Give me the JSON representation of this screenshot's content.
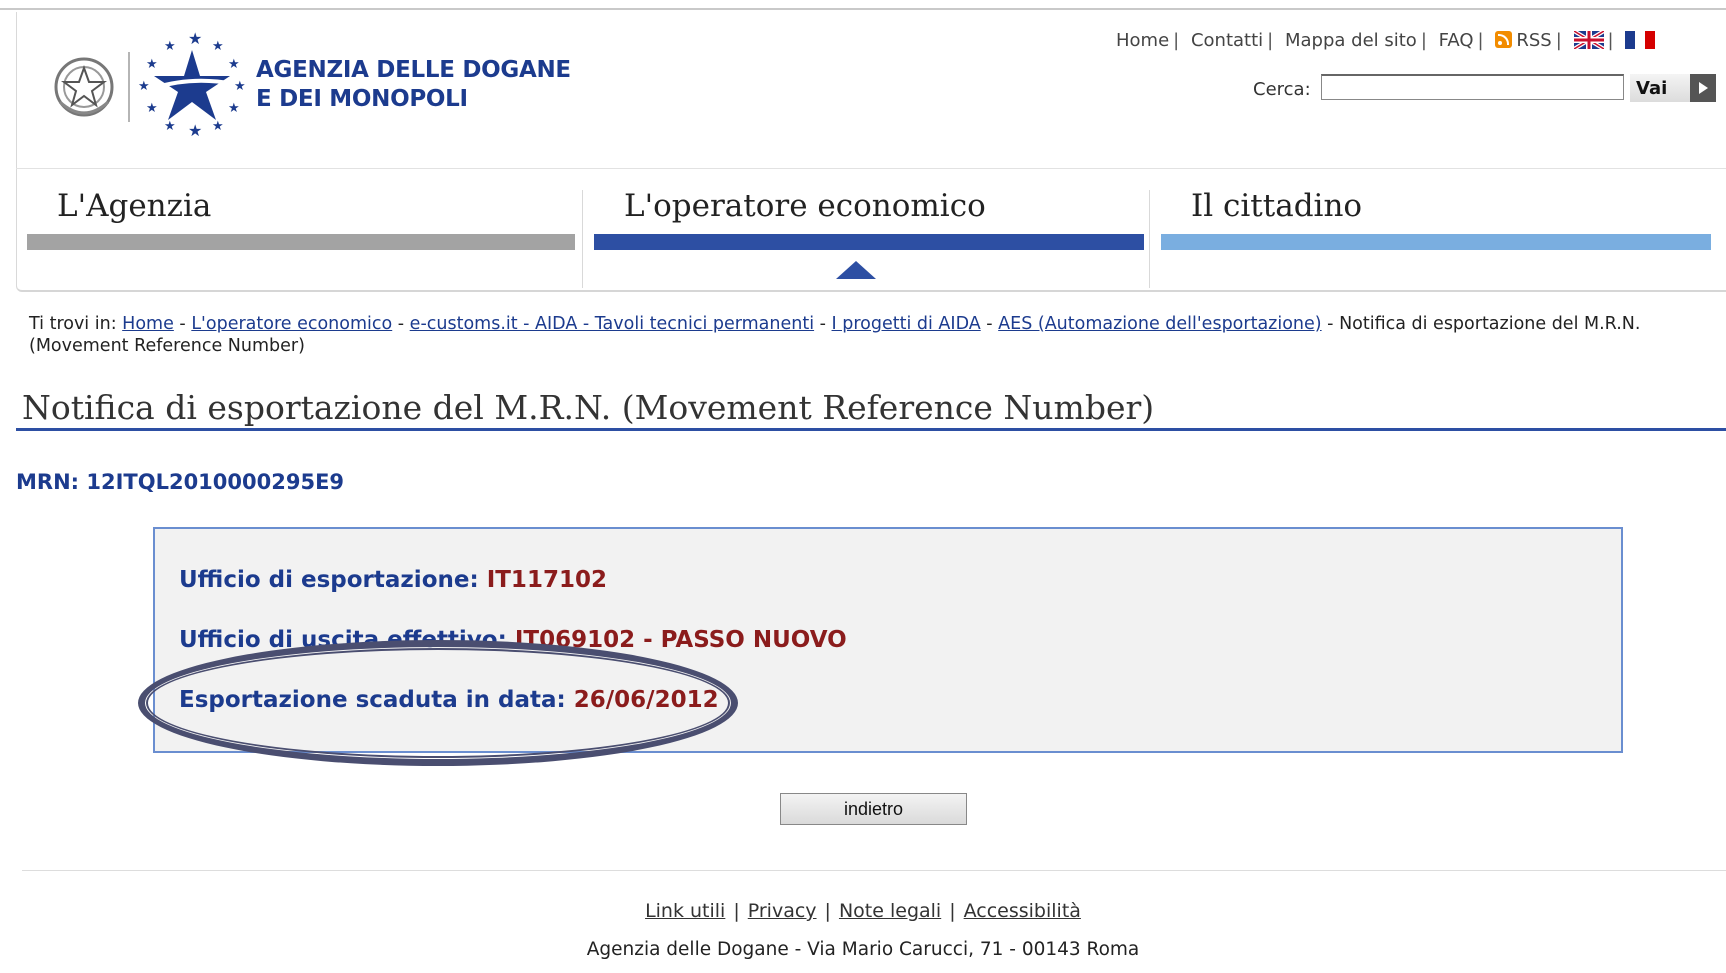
{
  "logo": {
    "line1": "AGENZIA DELLE DOGANE",
    "line2": "E DEI MONOPOLI"
  },
  "top_links": [
    {
      "label": "Home"
    },
    {
      "label": "Contatti"
    },
    {
      "label": "Mappa del sito"
    },
    {
      "label": "FAQ"
    },
    {
      "label": "RSS"
    }
  ],
  "search": {
    "label": "Cerca:",
    "value": "",
    "button": "Vai"
  },
  "nav": [
    {
      "label": "L'Agenzia",
      "color": "#a3a3a3"
    },
    {
      "label": "L'operatore economico",
      "color": "#2d4fa3"
    },
    {
      "label": "Il cittadino",
      "color": "#7aaee0"
    }
  ],
  "breadcrumb": {
    "prefix": "Ti trovi in:",
    "links": [
      "Home",
      "L'operatore economico",
      "e-customs.it - AIDA - Tavoli tecnici permanenti",
      "I progetti di AIDA",
      "AES (Automazione dell'esportazione)"
    ],
    "current": "Notifica di esportazione del M.R.N. (Movement Reference Number)"
  },
  "page": {
    "title": "Notifica di esportazione del M.R.N. (Movement Reference Number)",
    "mrn_label": "MRN:",
    "mrn_value": "12ITQL2010000295E9"
  },
  "details": [
    {
      "label": "Ufficio di esportazione:",
      "value": "IT117102"
    },
    {
      "label": "Ufficio di uscita effettivo:",
      "value": "IT069102 - PASSO NUOVO"
    },
    {
      "label": "Esportazione scaduta in data:",
      "value": "26/06/2012"
    }
  ],
  "back_button": "indietro",
  "footer": {
    "links": [
      "Link utili",
      "Privacy",
      "Note legali",
      "Accessibilità"
    ],
    "address": "Agenzia delle Dogane - Via Mario Carucci, 71 - 00143 Roma"
  },
  "colors": {
    "brand_blue": "#1c3b8e",
    "value_red": "#8b1c1c",
    "highlight_ellipse": "#4a4e70"
  }
}
